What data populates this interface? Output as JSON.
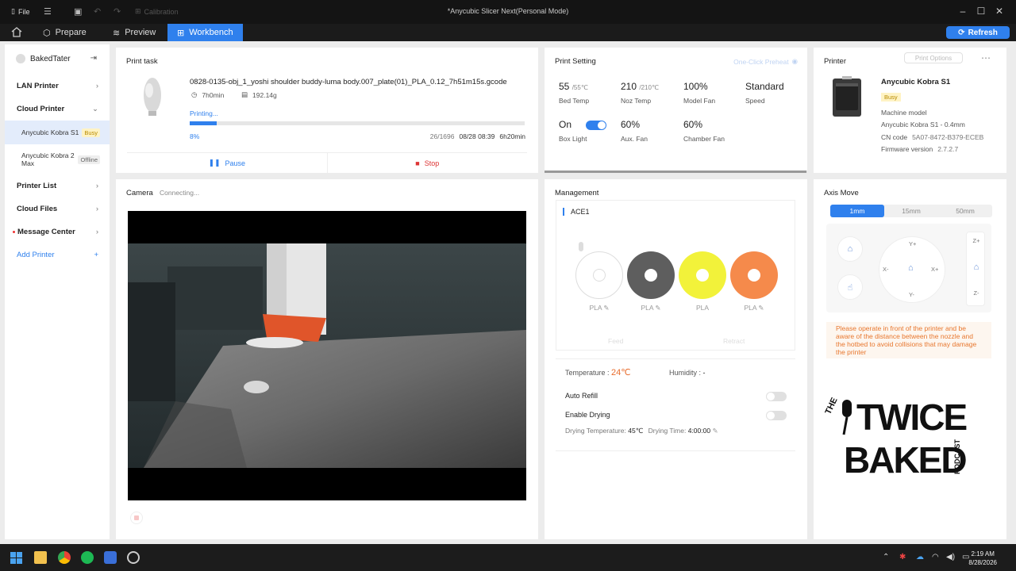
{
  "window": {
    "title": "*Anycubic Slicer Next(Personal Mode)",
    "file_label": "File",
    "calibration_label": "Calibration"
  },
  "tabs": [
    {
      "label": "Prepare"
    },
    {
      "label": "Preview"
    },
    {
      "label": "Workbench",
      "active": true
    }
  ],
  "refresh_label": "Refresh",
  "sidebar": {
    "user": "BakedTater",
    "lan_printer": "LAN Printer",
    "cloud_printer": "Cloud Printer",
    "printers": [
      {
        "name": "Anycubic Kobra S1",
        "status": "Busy"
      },
      {
        "name": "Anycubic Kobra 2 Max",
        "status": "Offline"
      }
    ],
    "printer_list": "Printer List",
    "cloud_files": "Cloud Files",
    "message_center": "Message Center",
    "add_printer": "Add Printer"
  },
  "print_task": {
    "title": "Print task",
    "filename": "0828-0135-obj_1_yoshi shoulder buddy-luma body.007_plate(01)_PLA_0.12_7h51m15s.gcode",
    "duration": "7h0min",
    "weight": "192.14g",
    "status": "Printing...",
    "progress_pct": "8%",
    "progress": 0.08,
    "layers": "26/1696",
    "eta": "08/28 08:39",
    "remaining": "6h20min",
    "pause_label": "Pause",
    "stop_label": "Stop"
  },
  "print_setting": {
    "title": "Print Setting",
    "one_click_preheat": "One-Click Preheat",
    "bed_temp": "55",
    "bed_target": "/55℃",
    "bed_label": "Bed Temp",
    "noz_temp": "210",
    "noz_target": "/210℃",
    "noz_label": "Noz Temp",
    "model_fan": "100%",
    "model_fan_label": "Model Fan",
    "speed": "Standard",
    "speed_label": "Speed",
    "box_light": "On",
    "box_light_label": "Box Light",
    "aux_fan": "60%",
    "aux_fan_label": "Aux. Fan",
    "chamber_fan": "60%",
    "chamber_fan_label": "Chamber Fan"
  },
  "printer": {
    "title": "Printer",
    "print_options": "Print Options",
    "name": "Anycubic Kobra S1",
    "status": "Busy",
    "machine_model_label": "Machine model",
    "machine_model": "Anycubic Kobra S1 - 0.4mm",
    "cn_code_label": "CN code",
    "cn_code": "5A07-8472-B379-ECEB",
    "firmware_label": "Firmware version",
    "firmware": "2.7.2.7"
  },
  "camera": {
    "title": "Camera",
    "status": "Connecting..."
  },
  "management": {
    "title": "Management",
    "ace_title": "ACE1",
    "spools": [
      {
        "label": "PLA",
        "color": "#ffffff"
      },
      {
        "label": "PLA",
        "color": "#5e5e5e"
      },
      {
        "label": "PLA",
        "color": "#f2f23a"
      },
      {
        "label": "PLA",
        "color": "#f58a4b"
      }
    ],
    "feed_label": "Feed",
    "retract_label": "Retract",
    "temperature_label": "Temperature :",
    "temperature": "24℃",
    "humidity_label": "Humidity :",
    "humidity": "-",
    "auto_refill": "Auto Refill",
    "enable_drying": "Enable Drying",
    "drying_temp_label": "Drying Temperature:",
    "drying_temp": "45℃",
    "drying_time_label": "Drying Time:",
    "drying_time": "4:00:00"
  },
  "axis_move": {
    "title": "Axis Move",
    "steps": [
      "1mm",
      "15mm",
      "50mm"
    ],
    "y_plus": "Y+",
    "y_minus": "Y-",
    "x_minus": "X-",
    "x_plus": "X+",
    "z_plus": "Z+",
    "z_minus": "Z-",
    "warning": "Please operate in front of the printer and be aware of the distance between the nozzle and the hotbed to avoid collisions that may damage the printer",
    "logo": {
      "the": "THE",
      "line1": "TWICE",
      "line2": "BAKED",
      "podcast": "PODCAST"
    }
  },
  "clock": {
    "time": "2:19 AM",
    "date": "8/28/2026"
  },
  "colors": {
    "accent": "#2f80ed",
    "busy": "#b78a00",
    "stop": "#d33333",
    "temp_orange": "#e86c2c"
  }
}
